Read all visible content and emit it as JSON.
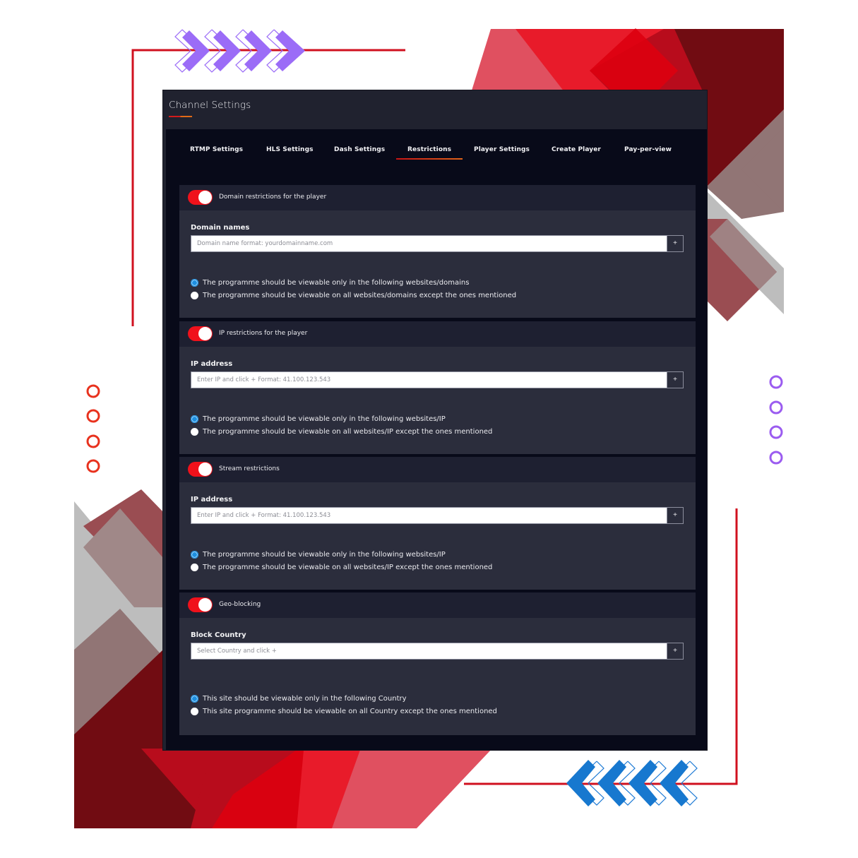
{
  "window": {
    "title": "Channel Settings"
  },
  "tabs": [
    {
      "label": "RTMP Settings",
      "active": false
    },
    {
      "label": "HLS Settings",
      "active": false
    },
    {
      "label": "Dash Settings",
      "active": false
    },
    {
      "label": "Restrictions",
      "active": true
    },
    {
      "label": "Player Settings",
      "active": false
    },
    {
      "label": "Create Player",
      "active": false
    },
    {
      "label": "Pay-per-view",
      "active": false
    }
  ],
  "sections": [
    {
      "title": "Domain restrictions for the player",
      "enabled": true,
      "field_label": "Domain names",
      "placeholder": "Domain name format: yourdomainname.com",
      "value": "",
      "add_label": "+",
      "options": [
        {
          "label": "The programme should be viewable only in the following websites/domains",
          "checked": true
        },
        {
          "label": "The programme should be viewable on all websites/domains except the ones mentioned",
          "checked": false
        }
      ]
    },
    {
      "title": "IP restrictions for the player",
      "enabled": true,
      "field_label": "IP address",
      "placeholder": "Enter IP and click + Format: 41.100.123.543",
      "value": "",
      "add_label": "+",
      "options": [
        {
          "label": "The programme should be viewable only in the following websites/IP",
          "checked": true
        },
        {
          "label": "The programme should be viewable on all websites/IP except the ones mentioned",
          "checked": false
        }
      ]
    },
    {
      "title": "Stream restrictions",
      "enabled": true,
      "field_label": "IP address",
      "placeholder": "Enter IP and click + Format: 41.100.123.543",
      "value": "",
      "add_label": "+",
      "options": [
        {
          "label": "The programme should be viewable only in the following websites/IP",
          "checked": true
        },
        {
          "label": "The programme should be viewable on all websites/IP except the ones mentioned",
          "checked": false
        }
      ]
    },
    {
      "title": "Geo-blocking",
      "enabled": true,
      "field_label": "Block Country",
      "placeholder": "Select Country and click +",
      "value": "",
      "add_label": "+",
      "options": [
        {
          "label": "This site should be viewable only in the following Country",
          "checked": true
        },
        {
          "label": "This site programme should be viewable on all Country except the ones mentioned",
          "checked": false
        }
      ]
    }
  ],
  "colors": {
    "accent_red": "#f0111b",
    "tab_underline_start": "#c81414",
    "tab_underline_end": "#e0641a",
    "radio_checked": "#1d8fe0",
    "window_bg": "#20222f",
    "panel_bg": "#080a19",
    "section_bg": "#2b2d3c",
    "section_header_bg": "#1e2031"
  }
}
